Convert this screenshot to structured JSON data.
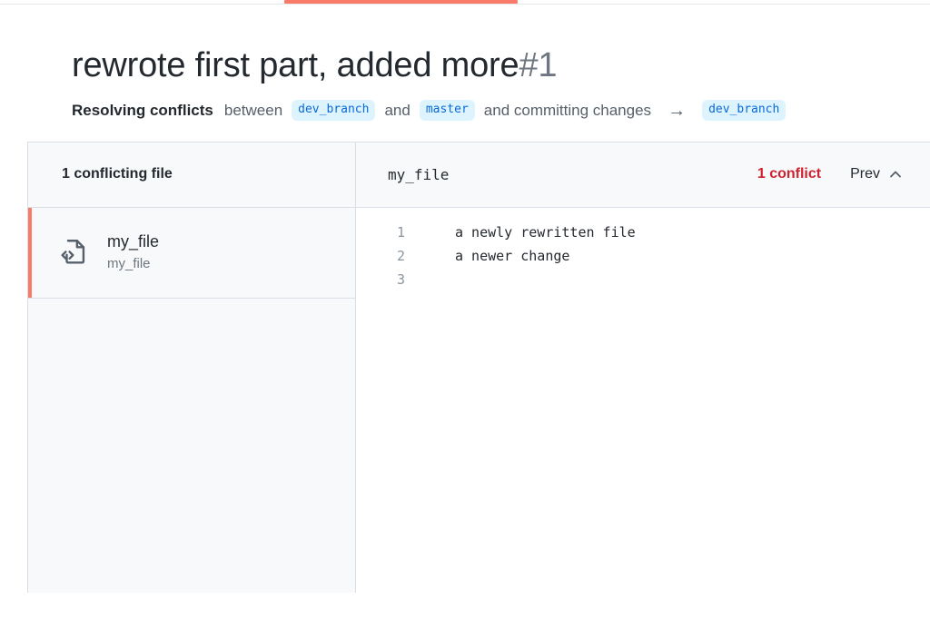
{
  "tabstrip": {
    "active_tab_indicator_color": "#fa7a69"
  },
  "header": {
    "title": "rewrote first part, added more",
    "number": "#1",
    "subtitle": {
      "action": "Resolving conflicts",
      "between_word": "between",
      "source_branch": "dev_branch",
      "and_word": "and",
      "target_branch": "master",
      "committing_text": "and committing changes",
      "arrow_glyph": "→",
      "result_branch": "dev_branch"
    }
  },
  "sidebar": {
    "header_title": "1 conflicting file",
    "files": [
      {
        "icon": "code-file-icon",
        "name": "my_file",
        "path": "my_file",
        "selected": true
      }
    ]
  },
  "editor": {
    "filename": "my_file",
    "conflict_count_label": "1 conflict",
    "prev_label": "Prev",
    "prev_icon": "chevron-up-icon",
    "lines": [
      {
        "no": "1",
        "code": "a newly rewritten file"
      },
      {
        "no": "2",
        "code": "a newer change"
      },
      {
        "no": "3",
        "code": ""
      }
    ]
  },
  "colors": {
    "accent_orange": "#fa7a69",
    "conflict_red": "#cf222e",
    "branch_pill_bg": "#ddf4ff",
    "branch_pill_text": "#0969da",
    "panel_bg": "#f8f9fb",
    "border": "#d8dee4",
    "muted_text": "#6e7781"
  }
}
